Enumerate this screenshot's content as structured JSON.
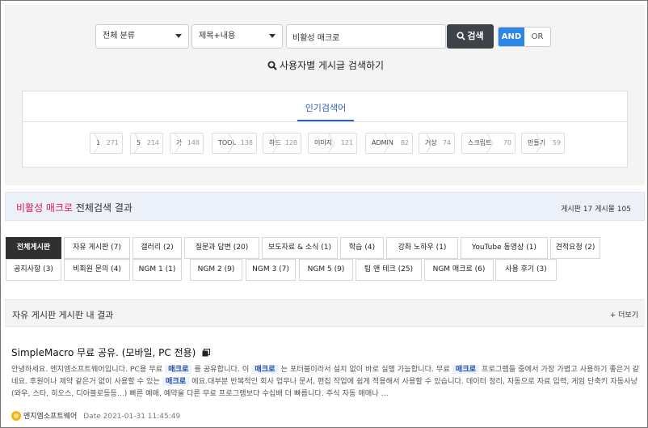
{
  "search": {
    "category_value": "전체 분류",
    "field_value": "제목+내용",
    "keyword_value": "비활성 매크로",
    "search_button": "검색",
    "and_label": "AND",
    "or_label": "OR",
    "user_search_link": "사용자별 게시글 검색하기"
  },
  "popular": {
    "title": "인기검색어",
    "tags": [
      {
        "name": "1",
        "count": "271"
      },
      {
        "name": "5",
        "count": "214"
      },
      {
        "name": "가",
        "count": "148"
      },
      {
        "name": "TOOL",
        "count": "138"
      },
      {
        "name": "하드",
        "count": "128"
      },
      {
        "name": "이미지",
        "count": "121"
      },
      {
        "name": "ADMIN",
        "count": "82"
      },
      {
        "name": "거상",
        "count": "74"
      },
      {
        "name": "스크립트",
        "count": "70"
      },
      {
        "name": "만들기",
        "count": "59"
      }
    ]
  },
  "result": {
    "keyword": "비활성 매크로",
    "suffix": "전체검색 결과",
    "counts": "게시판 17  게시물 105"
  },
  "tabs_row1": [
    "전체게시판",
    "자유 게시판 (7)",
    "갤러리 (2)",
    "질문과 답변 (20)",
    "보도자료 & 소식 (1)",
    "학습 (4)",
    "강좌 노하우 (1)",
    "YouTube 동영상 (1)",
    "견적요청 (2)"
  ],
  "tabs_row2": [
    "공지사항 (3)",
    "비회원 문의 (4)",
    "NGM 1 (1)",
    "NGM 2 (9)",
    "NGM 3 (7)",
    "NGM 5 (9)",
    "팁 앤 테크 (25)",
    "NGM 매크로 (6)",
    "사용 후기 (3)"
  ],
  "section": {
    "title": "자유 게시판 게시판 내 결과",
    "more": "+ 더보기"
  },
  "post": {
    "title": "SimpleMacro 무료 공유. (모바일, PC 전용)",
    "body": {
      "t1": "안녕하세요. 엔지엠소프트웨어입니다. PC용 무료 ",
      "h1": "매크로",
      "t2": " 를 공유합니다. 이 ",
      "h2": "매크로",
      "t3": " 는 포터블이라서 설치 없이 바로 실행 가능합니다. 무료 ",
      "h3": "매크로",
      "t4": " 프로그램들 중에서 가장 가볍고 사용하기 좋은거 같네요. 후원이나 제약 같은거 없이 사용할 수 있는 ",
      "h4": "매크로",
      "t5": " 에요.대부분 반복적인 회사 업무나 문서, 편집 작업에 쉽게 적용해서 사용할 수 있습니다. 데이터 정리, 자동으로 자료 입력, 게임 단축키 자동사냥(와우, 스타, 히오스, 디아블로등등...) 빠른 예매, 예약을 다른 무료 프로그램보다 수십배 더 빠릅니다. 주식 자동 매매나 …"
    },
    "author": "엔지엠소프트웨어",
    "date": "Date 2021-01-31 11:45:49"
  },
  "colors": {
    "accent_blue": "#2b86e5",
    "keyword_pink": "#e0195d",
    "active_tab": "#303030",
    "search_button": "#3d4348"
  },
  "icons": [
    "search-icon",
    "document-icon",
    "avatar-icon",
    "chevron-down-icon"
  ]
}
